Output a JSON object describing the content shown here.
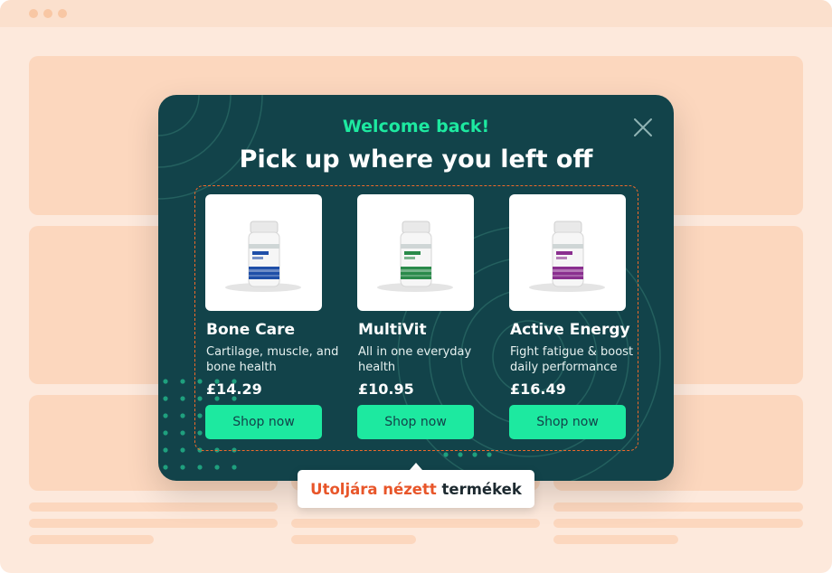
{
  "popup": {
    "greeting": "Welcome back!",
    "headline": "Pick up where you left off",
    "products": [
      {
        "name": "Bone Care",
        "description": "Cartilage, muscle, and bone health",
        "price": "£14.29",
        "button": "Shop now",
        "label_color": "#1f4fa8"
      },
      {
        "name": "MultiVit",
        "description": "All in one everyday health",
        "price": "£10.95",
        "button": "Shop now",
        "label_color": "#2a8a4a"
      },
      {
        "name": "Active Energy",
        "description": "Fight fatigue & boost daily performance",
        "price": "£16.49",
        "button": "Shop now",
        "label_color": "#8a2f8f"
      }
    ]
  },
  "callout": {
    "highlight": "Utoljára nézett",
    "rest": "termékek"
  },
  "colors": {
    "popup_bg": "#12434a",
    "accent": "#1de9a0",
    "dashed_outline": "#f06a2b",
    "callout_highlight": "#e8562a",
    "page_bg": "#fde9dc"
  }
}
